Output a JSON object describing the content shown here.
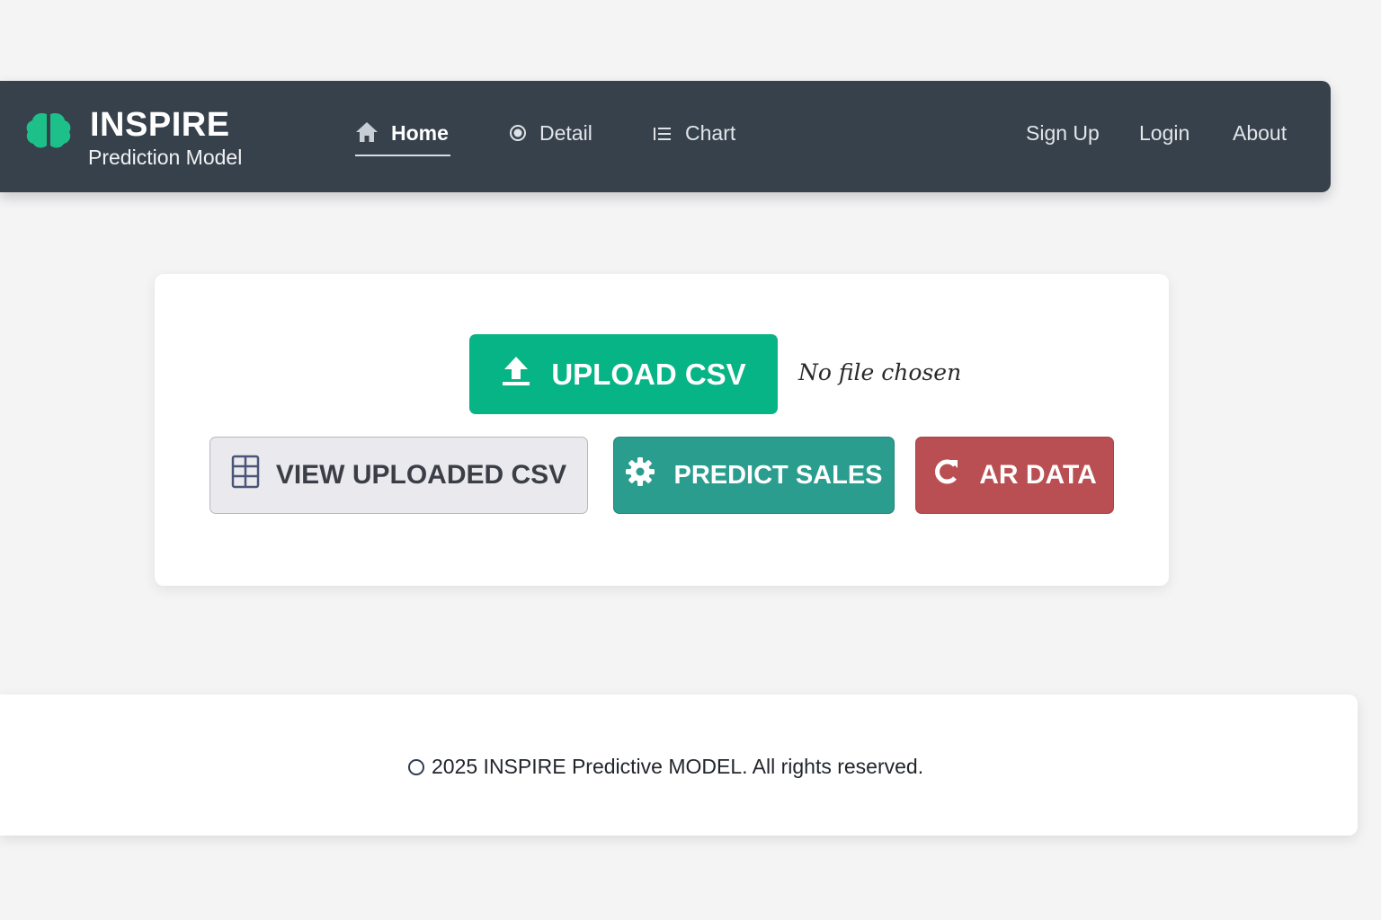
{
  "brand": {
    "title": "INSPIRE",
    "subtitle": "Prediction Model",
    "icon": "brain-icon",
    "icon_color": "#1ec08a"
  },
  "nav": {
    "left_links": [
      {
        "label": "Home",
        "icon": "home-icon",
        "active": true
      },
      {
        "label": "Detail",
        "icon": "radio-icon",
        "active": false
      },
      {
        "label": "Chart",
        "icon": "list-icon",
        "active": false
      }
    ],
    "right_links": [
      {
        "label": "Sign Up"
      },
      {
        "label": "Login"
      },
      {
        "label": "About"
      }
    ]
  },
  "upload": {
    "button_label": "UPLOAD CSV",
    "button_icon": "upload-icon",
    "file_status": "No file chosen"
  },
  "actions": {
    "view_label": "VIEW UPLOADED CSV",
    "view_icon": "table-icon",
    "predict_label": "PREDICT SALES",
    "predict_icon": "gear-icon",
    "clear_label": "AR DATA",
    "clear_icon": "refresh-icon"
  },
  "footer": {
    "text": "2025 INSPIRE Predictive MODEL. All rights reserved.",
    "icon": "copyright-icon"
  },
  "colors": {
    "navbar": "#37414b",
    "upload": "#07b486",
    "predict": "#2a9d8f",
    "clear": "#b94f52",
    "view": "#eae9ee"
  }
}
